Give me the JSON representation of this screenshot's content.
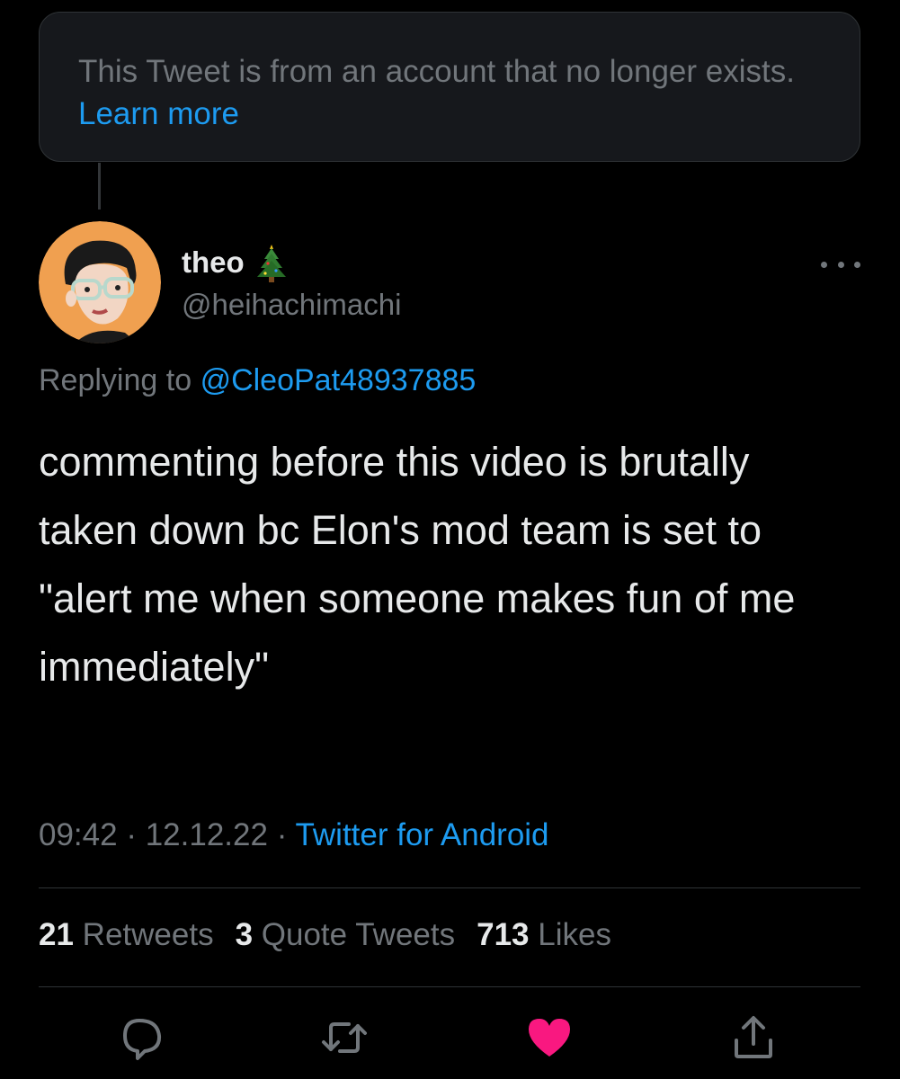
{
  "notice": {
    "text": "This Tweet is from an account that no longer exists.",
    "link": "Learn more"
  },
  "tweet": {
    "author_name": "theo",
    "author_emoji": "christmas-tree-icon",
    "author_handle": "@heihachimachi",
    "replying_label": "Replying to",
    "replying_to": "@CleoPat48937885",
    "text": "commenting before this video is brutally taken down bc Elon's mod team is set to \"alert me when someone makes fun of me immediately\"",
    "time": "09:42",
    "date": "12.12.22",
    "source": "Twitter for Android",
    "separator": "·"
  },
  "stats": {
    "retweets_count": "21",
    "retweets_label": "Retweets",
    "quotes_count": "3",
    "quotes_label": "Quote Tweets",
    "likes_count": "713",
    "likes_label": "Likes"
  },
  "actions": {
    "reply_icon": "reply-icon",
    "retweet_icon": "retweet-icon",
    "like_icon": "heart-icon-filled",
    "share_icon": "share-icon"
  },
  "colors": {
    "background": "#000000",
    "accent": "#1d9bf0",
    "muted": "#71767b",
    "like": "#f91880",
    "avatar_bg": "#f0a050"
  }
}
